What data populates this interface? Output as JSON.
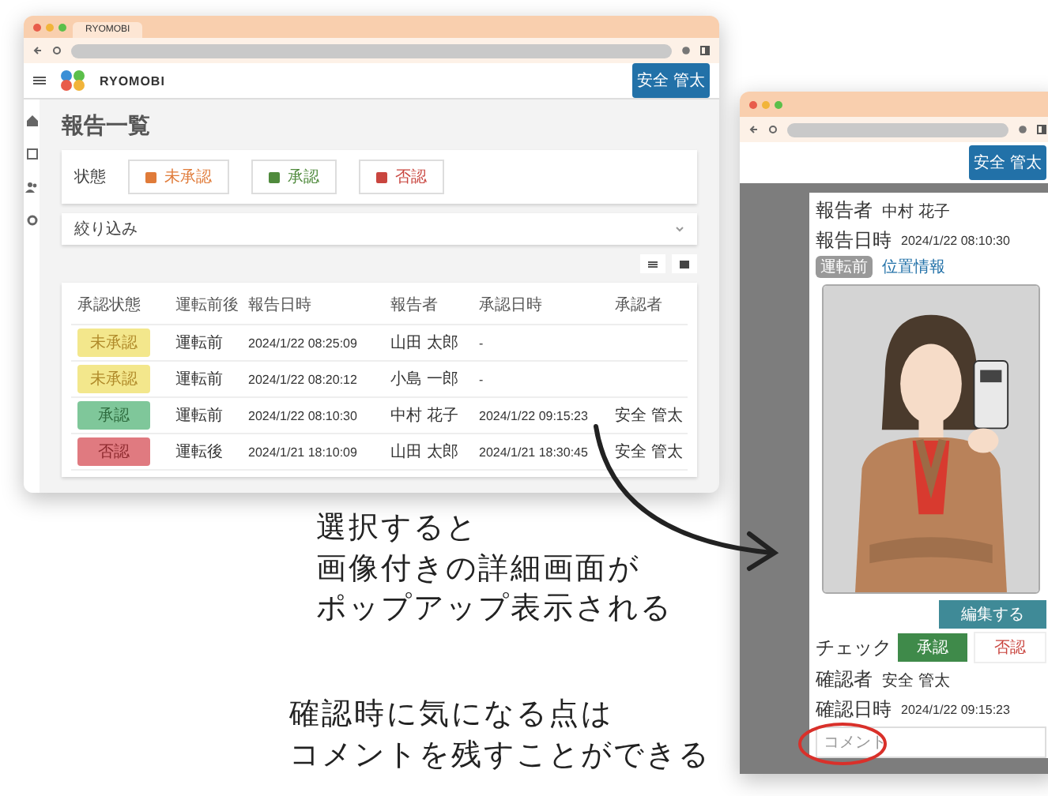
{
  "list_window": {
    "tab_title": "RYOMOBI",
    "app_name": "RYOMOBI",
    "user_button": "安全 管太",
    "page_title": "報告一覧",
    "status_filter": {
      "label": "状態",
      "options": [
        {
          "label": "未承認",
          "checked": true,
          "color": "#e07b39"
        },
        {
          "label": "承認",
          "checked": true,
          "color": "#4f8a3c"
        },
        {
          "label": "否認",
          "checked": true,
          "color": "#c9453f"
        }
      ]
    },
    "filter_panel": {
      "label": "絞り込み",
      "expanded": false
    },
    "table": {
      "columns": [
        "承認状態",
        "運転前後",
        "報告日時",
        "報告者",
        "承認日時",
        "承認者"
      ],
      "rows": [
        {
          "kind": "pending",
          "cells": [
            "未承認",
            "運転前",
            "2024/1/22 08:25:09",
            "山田 太郎",
            "-",
            ""
          ]
        },
        {
          "kind": "pending",
          "cells": [
            "未承認",
            "運転前",
            "2024/1/22 08:20:12",
            "小島 一郎",
            "-",
            ""
          ]
        },
        {
          "kind": "approved",
          "cells": [
            "承認",
            "運転前",
            "2024/1/22 08:10:30",
            "中村 花子",
            "2024/1/22 09:15:23",
            "安全 管太"
          ]
        },
        {
          "kind": "rejected",
          "cells": [
            "否認",
            "運転後",
            "2024/1/21 18:10:09",
            "山田 太郎",
            "2024/1/21 18:30:45",
            "安全 管太"
          ]
        }
      ]
    }
  },
  "detail_window": {
    "user_button": "安全 管太",
    "reporter_label": "報告者",
    "reporter": "中村 花子",
    "reported_at_label": "報告日時",
    "reported_at": "2024/1/22 08:10:30",
    "phase_badge": "運転前",
    "location_link": "位置情報",
    "edit_button": "編集する",
    "check_label": "チェック",
    "approve_button": "承認",
    "reject_button": "否認",
    "confirmer_label": "確認者",
    "confirmer": "安全 管太",
    "confirmed_at_label": "確認日時",
    "confirmed_at": "2024/1/22 09:15:23",
    "comment_label": "コメント"
  },
  "annotations": [
    {
      "lines": [
        "選択すると",
        "画像付きの詳細画面が",
        "ポップアップ表示される"
      ]
    },
    {
      "lines": [
        "確認時に気になる点は",
        "コメントを残すことができる"
      ]
    }
  ]
}
